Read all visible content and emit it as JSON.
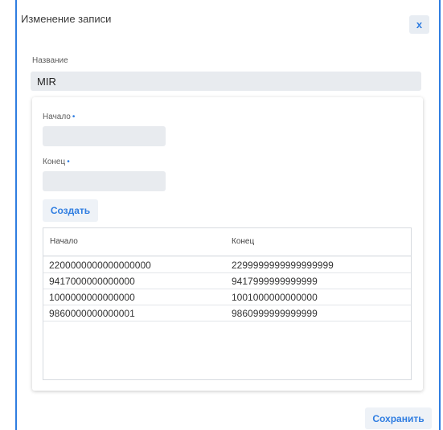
{
  "dialog": {
    "title": "Изменение записи",
    "close_label": "x"
  },
  "name_field": {
    "label": "Название",
    "value": "MIR"
  },
  "range_form": {
    "start_label": "Начало",
    "end_label": "Конец",
    "required_mark": "•",
    "start_value": "",
    "end_value": "",
    "create_label": "Создать"
  },
  "table": {
    "columns": [
      "Начало",
      "Конец"
    ],
    "rows": [
      [
        "2200000000000000000",
        "2299999999999999999"
      ],
      [
        "9417000000000000",
        "9417999999999999"
      ],
      [
        "1000000000000000",
        "1001000000000000"
      ],
      [
        "9860000000000001",
        "9860999999999999"
      ]
    ]
  },
  "footer": {
    "save_label": "Сохранить"
  },
  "colors": {
    "accent": "#2f7de1",
    "input_bg": "#e8ebef"
  }
}
